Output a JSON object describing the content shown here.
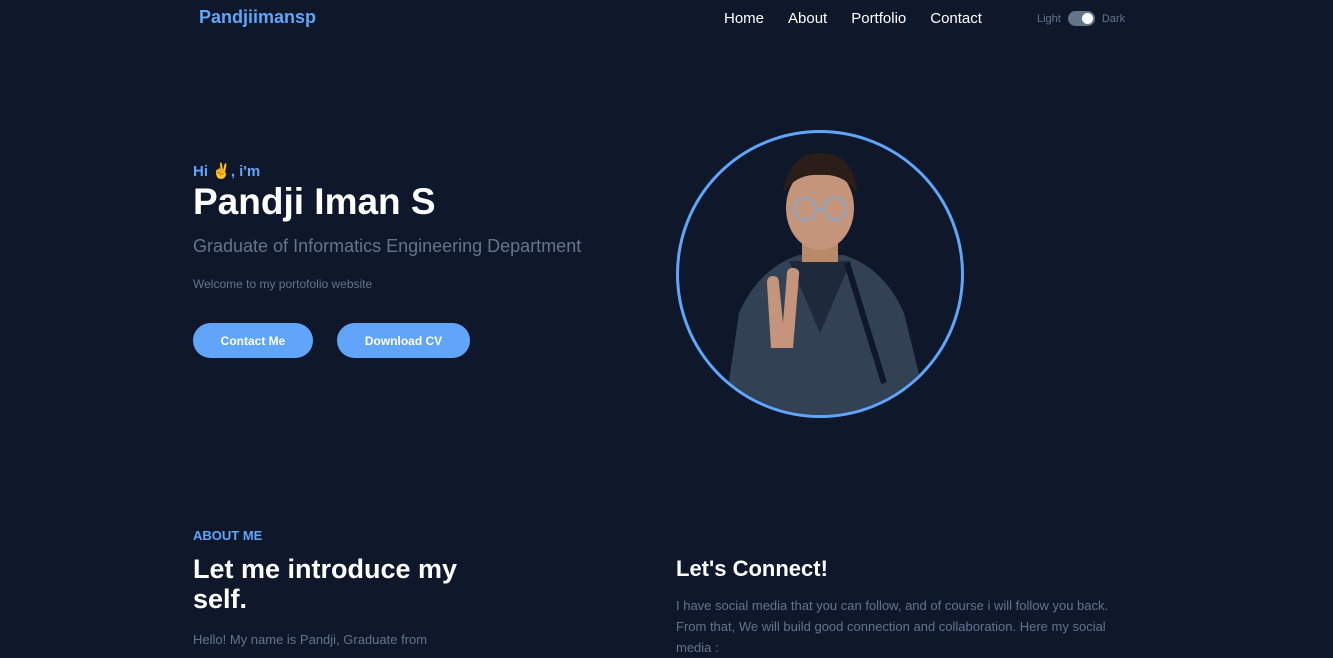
{
  "nav": {
    "logo": "Pandjiimansp",
    "links": [
      "Home",
      "About",
      "Portfolio",
      "Contact"
    ],
    "theme_light": "Light",
    "theme_dark": "Dark"
  },
  "hero": {
    "greeting": "Hi ✌️, i'm",
    "name": "Pandji Iman S",
    "subtitle": "Graduate of Informatics Engineering Department",
    "welcome": "Welcome to my portofolio website",
    "contact_button": "Contact Me",
    "cv_button": "Download CV"
  },
  "about": {
    "tag": "ABOUT ME",
    "title": "Let me introduce my self.",
    "text": "Hello! My name is Pandji, Graduate from",
    "connect_title": "Let's Connect!",
    "connect_text": "I have social media that you can follow, and of course i will follow you back. From that, We will build good connection and collaboration. Here my social media :"
  },
  "colors": {
    "background": "#0f172a",
    "accent": "#60a5fa",
    "muted": "#64748b"
  }
}
